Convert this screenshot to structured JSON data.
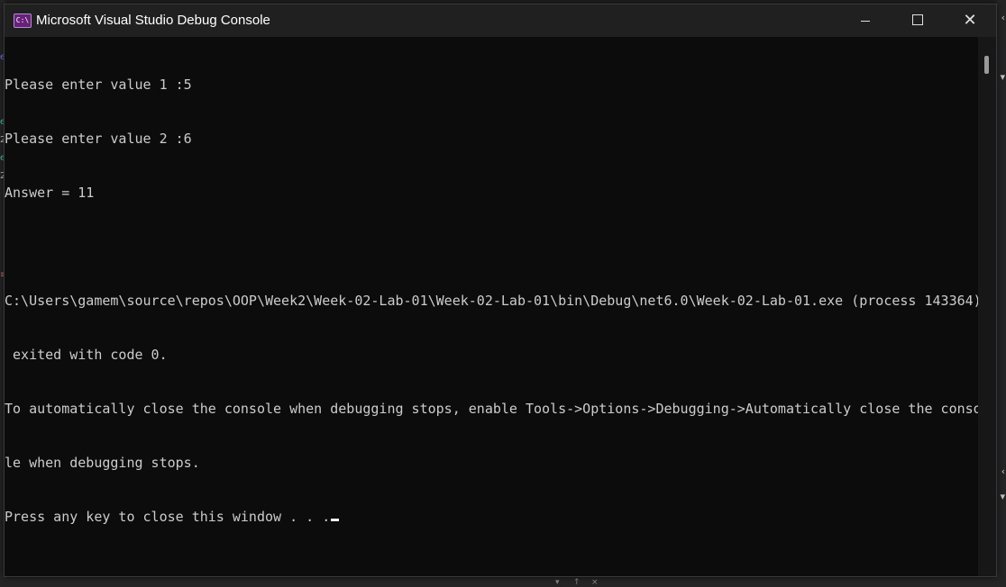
{
  "window": {
    "title": "Microsoft Visual Studio Debug Console",
    "icon_label": "C:\\",
    "minimize_label": "Minimize",
    "maximize_label": "Maximize",
    "close_label": "✕"
  },
  "console": {
    "lines": [
      "Please enter value 1 :5",
      "Please enter value 2 :6",
      "Answer = 11",
      "",
      "C:\\Users\\gamem\\source\\repos\\OOP\\Week2\\Week-02-Lab-01\\Week-02-Lab-01\\bin\\Debug\\net6.0\\Week-02-Lab-01.exe (process 143364)",
      " exited with code 0.",
      "To automatically close the console when debugging stops, enable Tools->Options->Debugging->Automatically close the conso",
      "le when debugging stops.",
      "Press any key to close this window . . ."
    ]
  },
  "colors": {
    "console_bg": "#0c0c0c",
    "console_fg": "#cccccc",
    "titlebar_bg": "#202020",
    "icon_bg": "#68217a"
  },
  "icons": {
    "app": "console-app-icon",
    "minimize": "minimize-icon",
    "maximize": "maximize-icon",
    "close": "close-icon"
  }
}
